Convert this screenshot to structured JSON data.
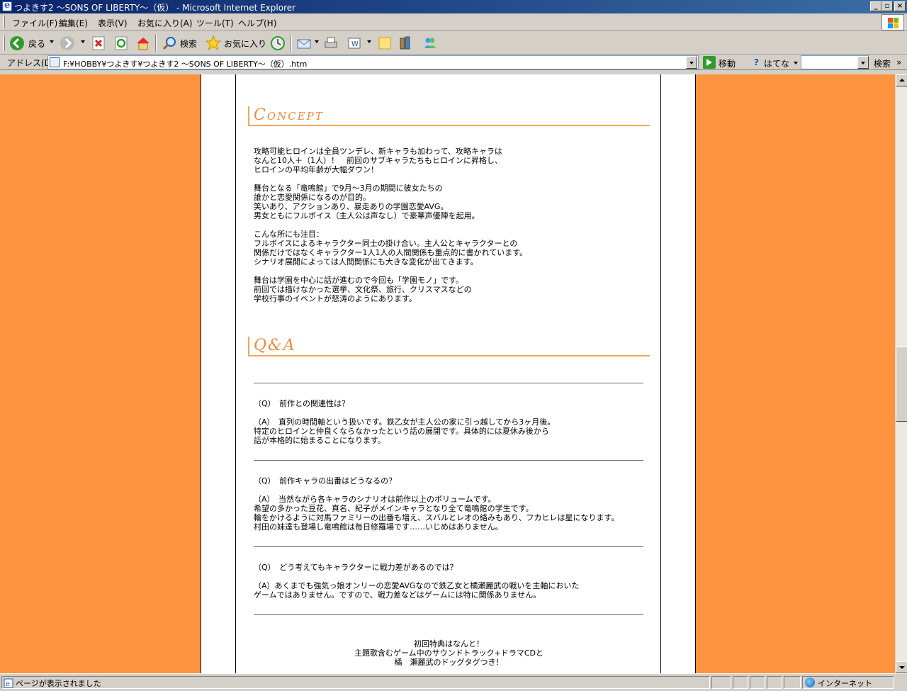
{
  "window": {
    "title": "つよきす2 ～SONS OF LIBERTY～（仮） - Microsoft Internet Explorer"
  },
  "menu": {
    "items": [
      "ファイル(F)",
      "編集(E)",
      "表示(V)",
      "お気に入り(A)",
      "ツール(T)",
      "ヘルプ(H)"
    ]
  },
  "toolbar": {
    "back_label": "戻る",
    "search_label": "検索",
    "favorites_label": "お気に入り"
  },
  "address": {
    "label": "アドレス(D)",
    "url": "F:¥HOBBY¥つよきす¥つよきす2 ～SONS OF LIBERTY～（仮）.htm",
    "go_label": "移動",
    "hatena_label": "はてな",
    "search_label": "検索"
  },
  "page": {
    "concept_heading": "Concept",
    "concept_paragraphs": [
      [
        "攻略可能ヒロインは全員ツンデレ、新キャラも加わって、攻略キャラは",
        "なんと10人＋（1人）！　前回のサブキャラたちもヒロインに昇格し、",
        "ヒロインの平均年齢が大幅ダウン！"
      ],
      [
        "舞台となる「竜鳴館」で9月～3月の期間に彼女たちの",
        "誰かと恋愛関係になるのが目的。",
        "笑いあり、アクションあり、暴走ありの学園恋愛AVG。",
        "男女ともにフルボイス（主人公は声なし）で豪華声優陣を起用。"
      ],
      [
        "こんな所にも注目：",
        "フルボイスによるキャラクター同士の掛け合い。主人公とキャラクターとの",
        "関係だけではなくキャラクター1人1人の人間関係も重点的に書かれています。",
        "シナリオ展開によっては人間関係にも大きな変化が出てきます。"
      ],
      [
        "舞台は学園を中心に話が進むので今回も「学園モノ」です。",
        "前回では描けなかった選挙、文化祭、旅行、クリスマスなどの",
        "学校行事のイベントが怒涛のようにあります。"
      ]
    ],
    "qa_heading": "Q&A",
    "qa": [
      {
        "q": "（Q）　前作との関連性は？",
        "a": [
          "（A）　直列の時間軸という扱いです。鉄乙女が主人公の家に引っ越してから3ヶ月後。",
          "特定のヒロインと仲良くならなかったという話の展開です。具体的には夏休み後から",
          "話が本格的に始まることになります。"
        ]
      },
      {
        "q": "（Q）　前作キャラの出番はどうなるの？",
        "a": [
          "（A）　当然ながら各キャラのシナリオは前作以上のボリュームです。",
          "希望の多かった豆花、真名、紀子がメインキャラとなり全て竜鳴館の学生です。",
          "輪をかけるように対馬ファミリーの出番も増え、スバルとレオの絡みもあり、フカヒレは星になります。",
          "村田の妹達も登場し竜鳴館は毎日修羅場です……いじめはありません。"
        ]
      },
      {
        "q": "（Q）　どう考えてもキャラクターに戦力差があるのでは？",
        "a": [
          "（A）あくまでも強気っ娘オンリーの恋愛AVGなので鉄乙女と橘瀬麗武の戦いを主軸においた",
          "ゲームではありません。ですので、戦力差などはゲームには特に関係ありません。"
        ]
      }
    ],
    "bonus_lines": [
      "初回特典はなんと！",
      "主題歌含むゲーム中のサウンドトラック+ドラマCDと",
      "橘　瀬麗武のドッグタグつき！"
    ]
  },
  "status": {
    "text": "ページが表示されました",
    "zone": "インターネット"
  },
  "scroll": {
    "position_fraction": 0.52
  }
}
